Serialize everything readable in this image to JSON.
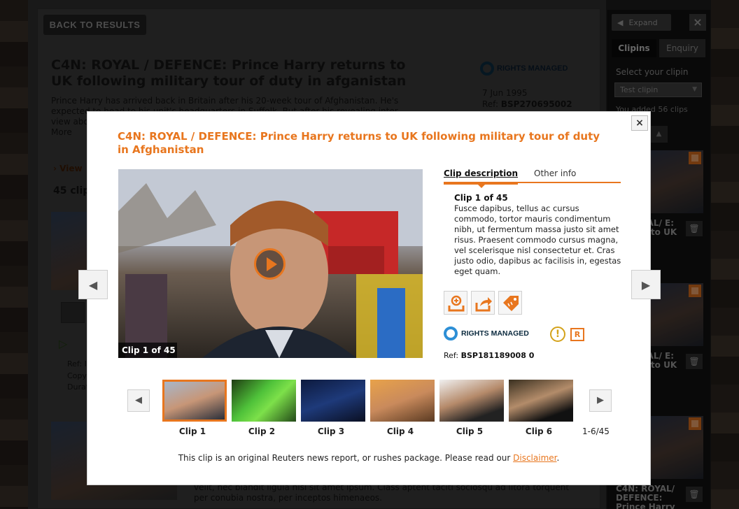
{
  "background": {
    "back_button": "BACK TO RESULTS",
    "title": "C4N: ROYAL / DEFENCE: Prince Harry returns to UK following military tour of duty in afganistan",
    "description": "Prince Harry has arrived back in Britain after his 20-week tour of Afghanistan. He's expected to head to his unit's headquarters in Suffolk. But after his revealing inter-view abo... little mo...",
    "more_link": "More",
    "rights_label": "RIGHTS MANAGED",
    "date": "7 Jun 1995",
    "ref_label": "Ref:",
    "ref_value": "BSP270695002",
    "view_link": "View",
    "clips_count": "45 clip",
    "meta_ref": "Ref: I",
    "meta_copy": "Copy",
    "meta_dur": "Durat",
    "desc2": "velit, nec blandit ligula nisi sit amet ipsum. Class aptent taciti sociosqu ad litora torquent per conubia nostra, per inceptos himenaeos."
  },
  "sidebar": {
    "expand_label": "Expand",
    "tabs": [
      "Clipins",
      "Enquiry"
    ],
    "select_label": "Select your clipin",
    "select_value": "Test clipin",
    "added_text": "You added 56 clips",
    "clip_title": "C4N: ROYAL / DEFENCE: Prince Harry returns to UK following...",
    "clip_title_short_1": "ROYAL/ E: arry to UK g...",
    "clip_title_last": "C4N: ROYAL/ DEFENCE: Prince Harry"
  },
  "modal": {
    "title": "C4N: ROYAL / DEFENCE: Prince Harry returns to UK following military tour of duty in Afghanistan",
    "video_label": "Clip 1 of 45",
    "tabs": {
      "active": "Clip description",
      "other": "Other info"
    },
    "clip_heading": "Clip 1 of 45",
    "clip_desc": "Fusce dapibus, tellus ac cursus commodo, tortor mauris condimentum nibh, ut fermentum massa justo sit amet risus. Praesent commodo cursus magna, vel scelerisque nisl consectetur et. Cras justo odio, dapibus ac facilisis in, egestas eget quam.",
    "rights_label": "RIGHTS MANAGED",
    "r_badge": "R",
    "ref_label": "Ref:",
    "ref_value": "BSP181189008 0",
    "thumbnails": [
      {
        "label": "Clip 1"
      },
      {
        "label": "Clip 2"
      },
      {
        "label": "Clip 3"
      },
      {
        "label": "Clip 4"
      },
      {
        "label": "Clip 5"
      },
      {
        "label": "Clip 6"
      }
    ],
    "range": "1-6/45",
    "footer_text": "This clip is an original Reuters news report, or rushes package. Please read our",
    "footer_link": "Disclaimer",
    "footer_end": "."
  },
  "colors": {
    "accent": "#e8761e",
    "rights_blue": "#2d8fd6"
  }
}
